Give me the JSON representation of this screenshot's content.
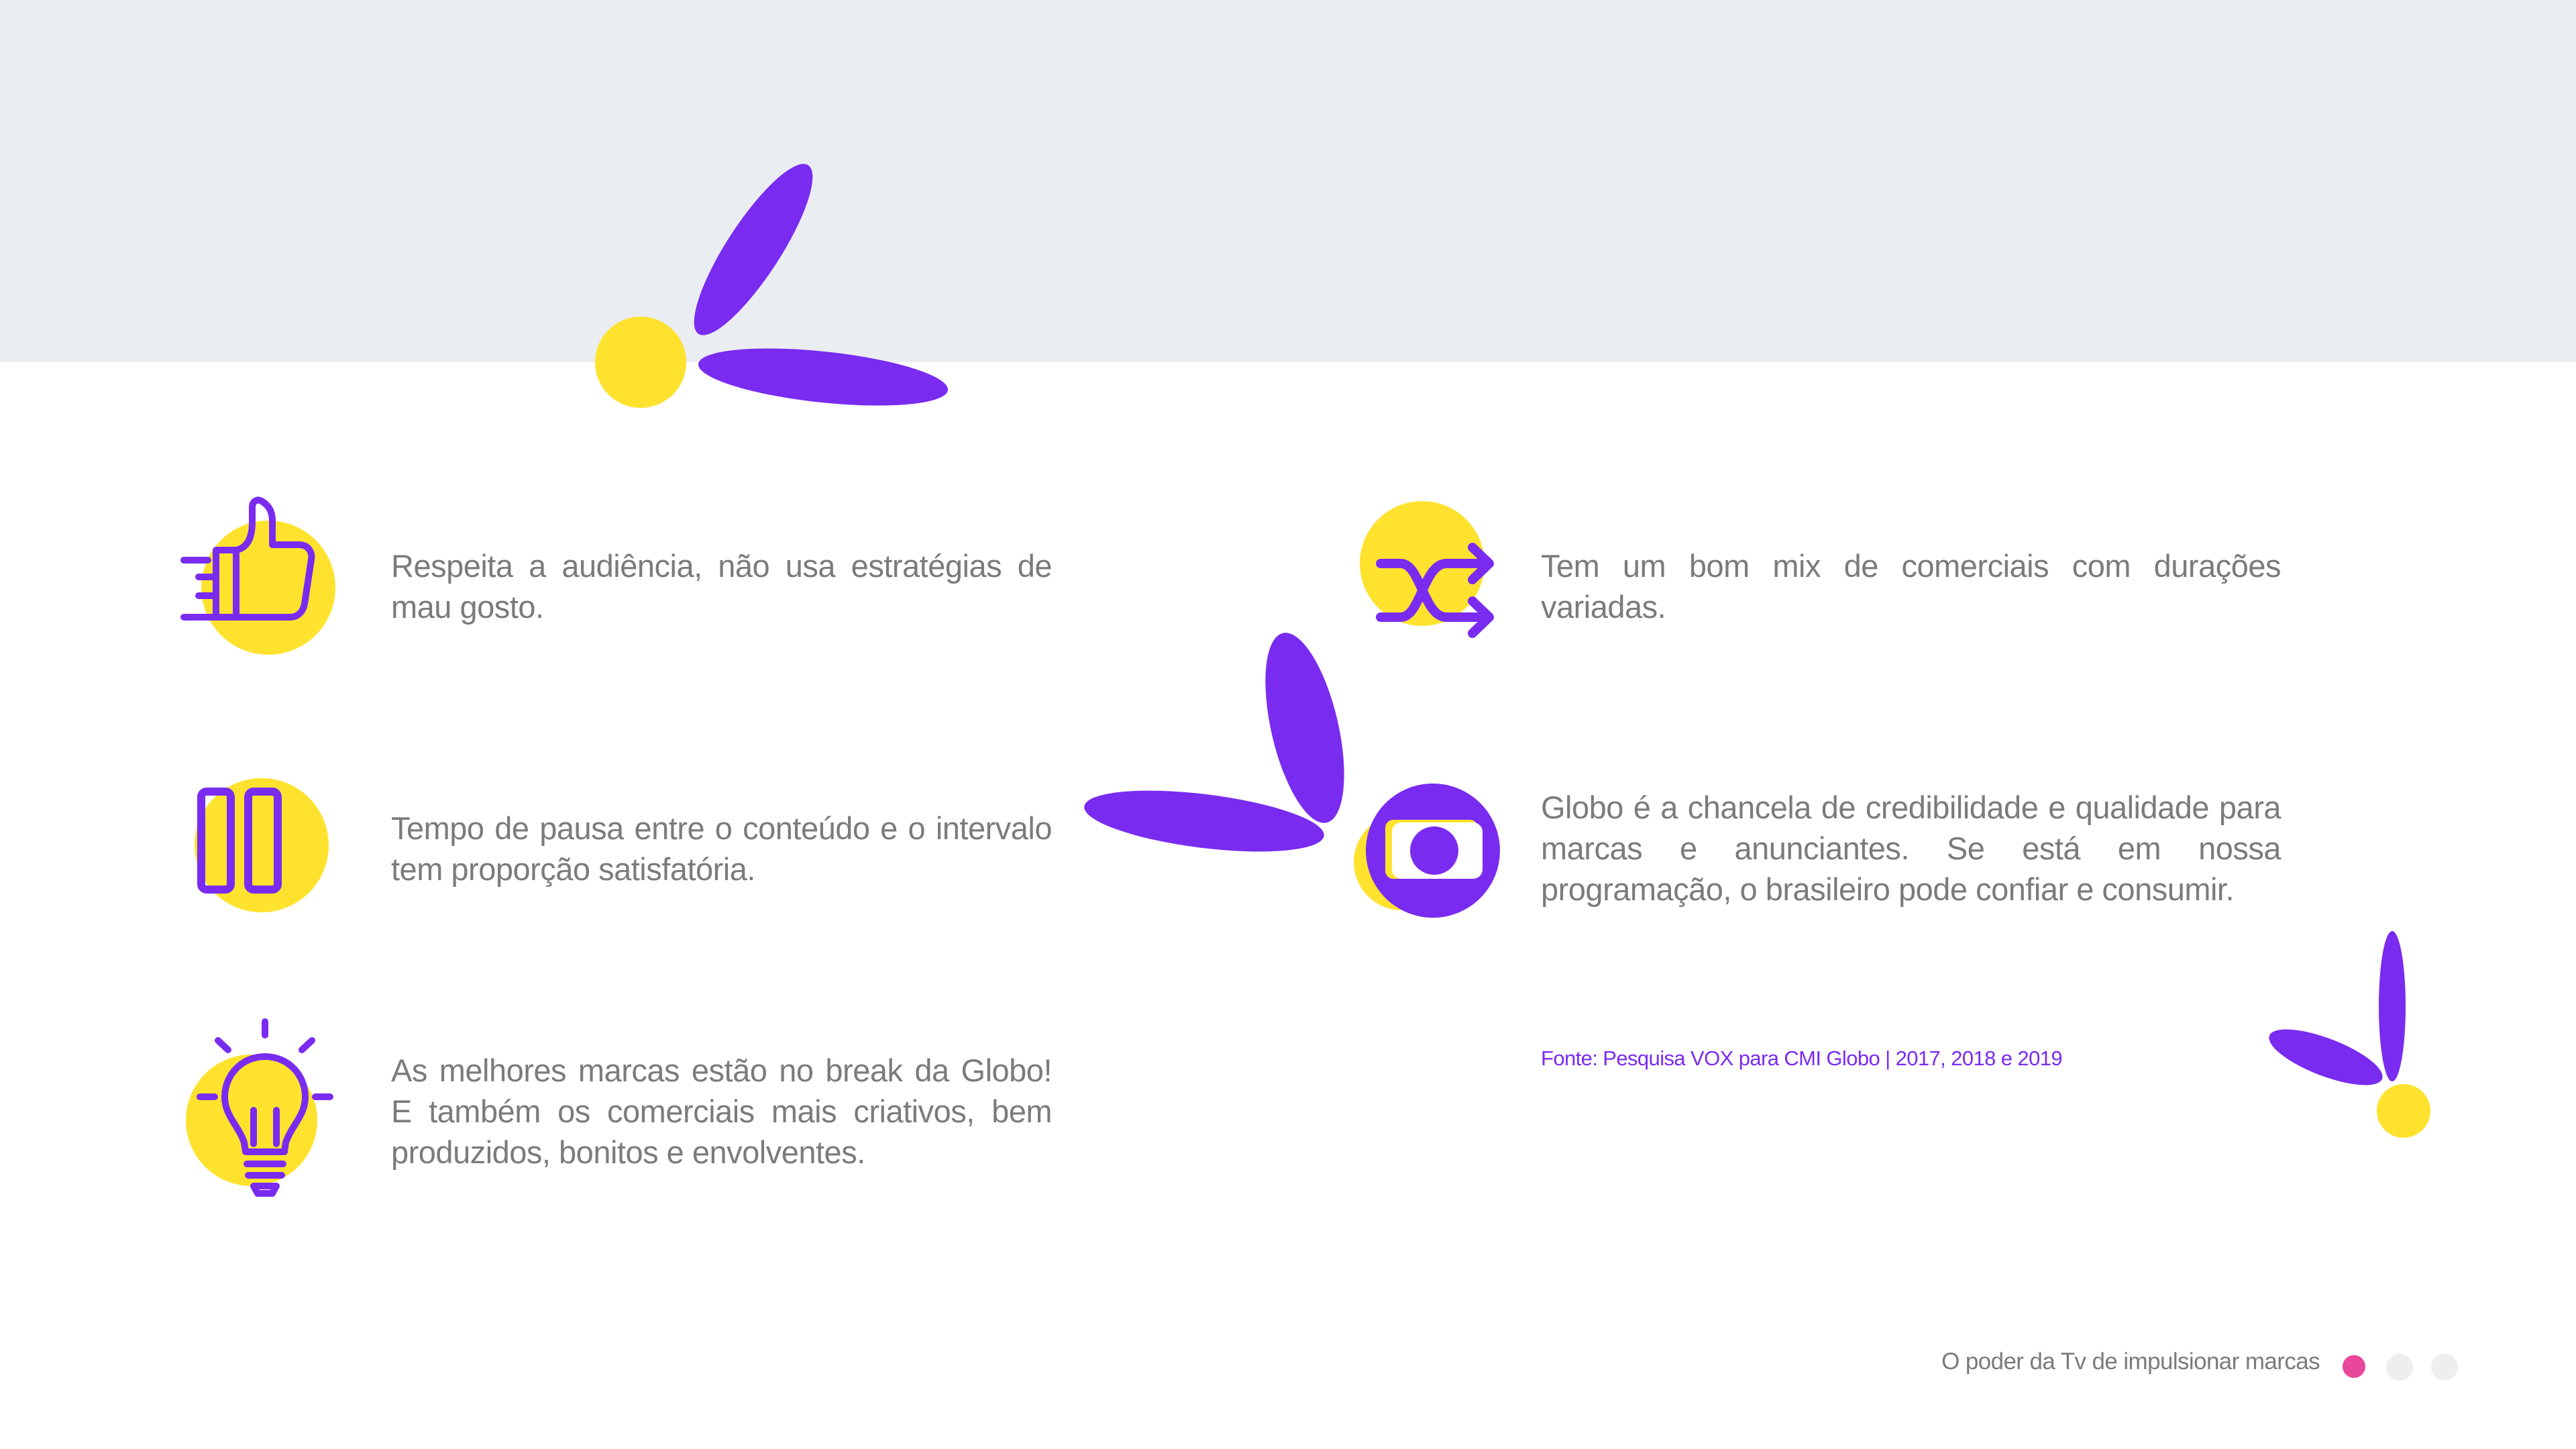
{
  "features": [
    {
      "icon": "thumbs-up-icon",
      "text": "Respeita a audiência, não usa estratégias de mau gosto."
    },
    {
      "icon": "pause-icon",
      "text": "Tempo de pausa entre o conteúdo e o intervalo tem proporção satisfatória."
    },
    {
      "icon": "lightbulb-icon",
      "text": "As melhores marcas estão no break da Globo! E também os comerciais mais criativos, bem produzidos, bonitos e envolventes."
    },
    {
      "icon": "shuffle-icon",
      "text": "Tem um bom mix de comerciais com durações variadas."
    },
    {
      "icon": "globo-logo-icon",
      "text": "Globo é a chancela de credibilidade e qualidade para marcas e anunciantes. Se está em nossa programação, o brasileiro pode confiar e consumir."
    }
  ],
  "source": "Fonte: Pesquisa VOX para CMI Globo | 2017, 2018 e 2019",
  "footer": {
    "title": "O poder da Tv de impulsionar marcas",
    "pagination": {
      "total": 3,
      "active": 1
    }
  },
  "colors": {
    "purple": "#7a2bf0",
    "yellow": "#ffe22e",
    "text": "#7b7b7b",
    "band": "#eaedf1",
    "dot_active": "#e8479a",
    "dot_inactive": "#eeeeee"
  }
}
